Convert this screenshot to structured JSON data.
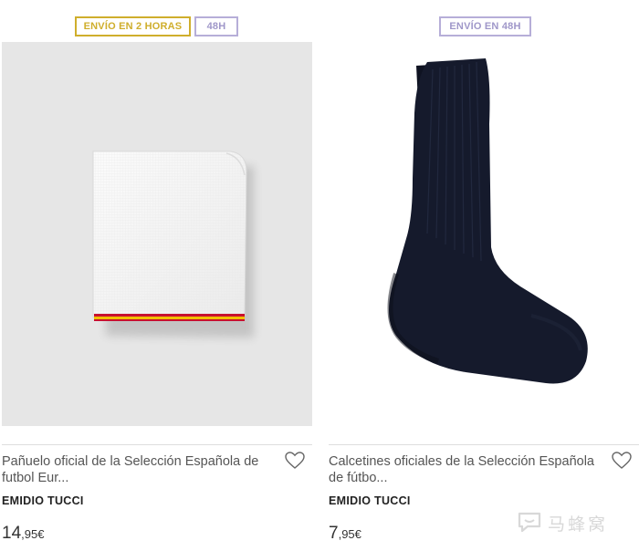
{
  "products": [
    {
      "badges": {
        "shipping": "ENVÍO EN 2 HORAS",
        "delivery": "48H"
      },
      "image_alt": "pocket-square-handkerchief",
      "title": "Pañuelo oficial de la Selección Española de futbol Eur...",
      "brand": "EMIDIO TUCCI",
      "price": {
        "integer": "14",
        "decimal": ",95",
        "currency": "€"
      }
    },
    {
      "badges": {
        "shipping": "ENVÍO EN 48H"
      },
      "image_alt": "navy-ribbed-sock",
      "title": "Calcetines oficiales de la Selección Española de fútbo...",
      "brand": "EMIDIO TUCCI",
      "price": {
        "integer": "7",
        "decimal": ",95",
        "currency": "€"
      }
    }
  ],
  "watermark": {
    "text": "马蜂窝"
  },
  "colors": {
    "gold_badge": "#cfae2c",
    "lilac_badge": "#b6aed8",
    "sock": "#151a2c",
    "flag_red": "#c8102e",
    "flag_yellow": "#f1bf00"
  }
}
